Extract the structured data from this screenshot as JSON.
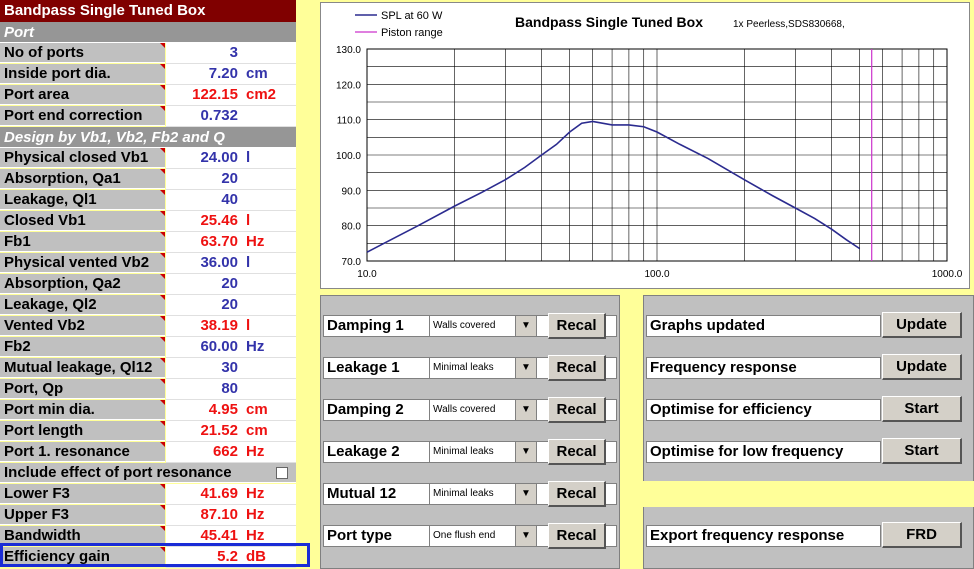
{
  "sheet": {
    "title": "Bandpass Single Tuned Box",
    "section_port": "Port",
    "port_rows": [
      {
        "label": "No of ports",
        "value": "3",
        "unit": "",
        "color": "blue"
      },
      {
        "label": "Inside port dia.",
        "value": "7.20",
        "unit": "cm",
        "color": "blue"
      },
      {
        "label": "Port area",
        "value": "122.15",
        "unit": "cm2",
        "color": "red"
      },
      {
        "label": "Port end correction",
        "value": "0.732",
        "unit": "",
        "color": "blue"
      }
    ],
    "section_design": "Design by Vb1, Vb2, Fb2 and Q",
    "design_rows": [
      {
        "label": "Physical closed Vb1",
        "value": "24.00",
        "unit": "l",
        "color": "blue"
      },
      {
        "label": "Absorption, Qa1",
        "value": "20",
        "unit": "",
        "color": "blue"
      },
      {
        "label": "Leakage, Ql1",
        "value": "40",
        "unit": "",
        "color": "blue"
      },
      {
        "label": "Closed Vb1",
        "value": "25.46",
        "unit": "l",
        "color": "red"
      },
      {
        "label": "Fb1",
        "value": "63.70",
        "unit": "Hz",
        "color": "red"
      },
      {
        "label": "Physical vented Vb2",
        "value": "36.00",
        "unit": "l",
        "color": "blue"
      },
      {
        "label": "Absorption, Qa2",
        "value": "20",
        "unit": "",
        "color": "blue"
      },
      {
        "label": "Leakage, Ql2",
        "value": "20",
        "unit": "",
        "color": "blue"
      },
      {
        "label": "Vented Vb2",
        "value": "38.19",
        "unit": "l",
        "color": "red"
      },
      {
        "label": "Fb2",
        "value": "60.00",
        "unit": "Hz",
        "color": "blue"
      },
      {
        "label": "Mutual leakage, Ql12",
        "value": "30",
        "unit": "",
        "color": "blue"
      },
      {
        "label": "Port, Qp",
        "value": "80",
        "unit": "",
        "color": "blue"
      },
      {
        "label": "Port min dia.",
        "value": "4.95",
        "unit": "cm",
        "color": "red"
      },
      {
        "label": "Port length",
        "value": "21.52",
        "unit": "cm",
        "color": "red"
      },
      {
        "label": "Port 1. resonance",
        "value": "662",
        "unit": "Hz",
        "color": "red"
      }
    ],
    "include_resonance_label": "Include effect of port resonance",
    "result_rows": [
      {
        "label": "Lower F3",
        "value": "41.69",
        "unit": "Hz",
        "color": "red"
      },
      {
        "label": "Upper F3",
        "value": "87.10",
        "unit": "Hz",
        "color": "red"
      },
      {
        "label": "Bandwidth",
        "value": "45.41",
        "unit": "Hz",
        "color": "red"
      },
      {
        "label": "Efficiency gain",
        "value": "5.2",
        "unit": "dB",
        "color": "red"
      }
    ]
  },
  "controls": {
    "rows": [
      {
        "label": "Damping 1",
        "option": "Walls covered",
        "button": "Recal"
      },
      {
        "label": "Leakage 1",
        "option": "Minimal leaks",
        "button": "Recal"
      },
      {
        "label": "Damping 2",
        "option": "Walls covered",
        "button": "Recal"
      },
      {
        "label": "Leakage 2",
        "option": "Minimal leaks",
        "button": "Recal"
      },
      {
        "label": "Mutual 12",
        "option": "Minimal leaks",
        "button": "Recal"
      },
      {
        "label": "Port type",
        "option": "One flush end",
        "button": "Recal"
      }
    ]
  },
  "actions": {
    "rows": [
      {
        "label": "Graphs updated",
        "button": "Update"
      },
      {
        "label": "Frequency response",
        "button": "Update"
      },
      {
        "label": "Optimise for efficiency",
        "button": "Start"
      },
      {
        "label": "Optimise for low frequency",
        "button": "Start"
      },
      {
        "label": "Export frequency response",
        "button": "FRD"
      }
    ]
  },
  "colors": {
    "title_bg": "#800000",
    "label_bg": "#c0c0c0",
    "background": "#ffff99",
    "highlight": "#1a2cd6",
    "spl_line": "#2b2b8f",
    "piston_line": "#cc33cc"
  },
  "chart_data": {
    "type": "line",
    "title": "Bandpass Single Tuned Box",
    "subtitle": "1x Peerless,SDS830668,",
    "x_scale": "log",
    "xlim": [
      10,
      1000
    ],
    "ylim": [
      70,
      130
    ],
    "x_ticks": [
      "10.0",
      "100.0",
      "1000.0"
    ],
    "y_ticks": [
      "70.0",
      "80.0",
      "90.0",
      "100.0",
      "110.0",
      "120.0",
      "130.0"
    ],
    "grid": true,
    "legend_position": "top-left",
    "series": [
      {
        "name": "SPL at 60 W",
        "x": [
          10,
          15,
          20,
          25,
          30,
          35,
          40,
          45,
          50,
          55,
          60,
          70,
          80,
          90,
          100,
          120,
          150,
          200,
          250,
          300,
          350,
          400,
          450,
          500
        ],
        "y": [
          72.5,
          80,
          85.5,
          89.5,
          93,
          96.5,
          100,
          103,
          106.5,
          109,
          109.5,
          108.5,
          108.5,
          108,
          106.5,
          103,
          99,
          93,
          88.5,
          85,
          82,
          79,
          76,
          73.5
        ]
      },
      {
        "name": "Piston range",
        "x": [
          550,
          550
        ],
        "y": [
          70,
          130
        ]
      }
    ]
  }
}
